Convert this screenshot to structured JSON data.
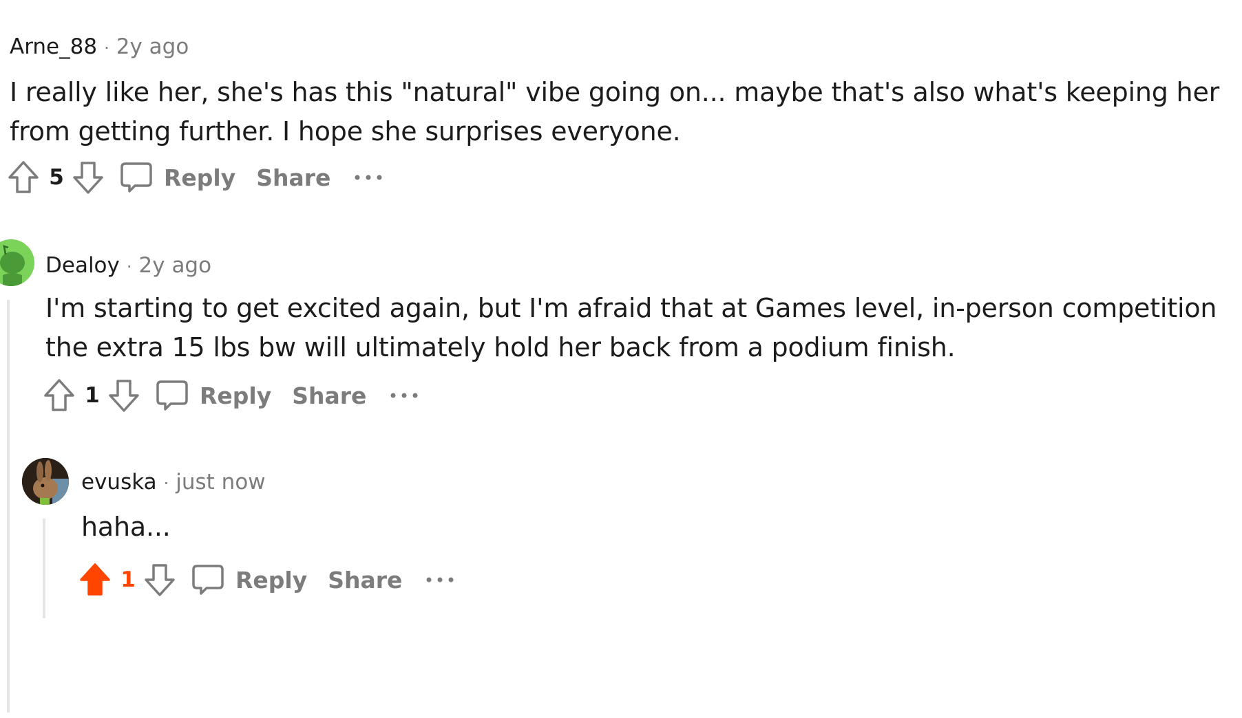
{
  "colors": {
    "upvoted": "#ff4500",
    "muted": "#7c7c7c",
    "text": "#1c1c1c",
    "thread_line": "#e5e5e5",
    "avatar_green": "#7bd35a"
  },
  "comments": [
    {
      "username": "Arne_88",
      "separator": "·",
      "time": "2y ago",
      "lines": [
        "I really like her, she's has this \"natural\" vibe going on... maybe that's also what's keeping her",
        "from getting further. I hope she surprises everyone."
      ],
      "score": "5",
      "upvoted": false,
      "reply_label": "Reply",
      "share_label": "Share",
      "more_icon": "more-icon"
    },
    {
      "username": "Dealoy",
      "separator": "·",
      "time": "2y ago",
      "avatar_icon": "snoo-avatar-green",
      "lines": [
        "I'm starting to get excited again, but I'm afraid that at Games level, in-person competition",
        "the extra 15 lbs bw will ultimately hold her back from a podium finish."
      ],
      "score": "1",
      "upvoted": false,
      "reply_label": "Reply",
      "share_label": "Share",
      "more_icon": "more-icon"
    },
    {
      "username": "evuska",
      "separator": "·",
      "time": "just now",
      "avatar_icon": "rabbit-photo-avatar",
      "lines": [
        "haha..."
      ],
      "score": "1",
      "upvoted": true,
      "reply_label": "Reply",
      "share_label": "Share",
      "more_icon": "more-icon"
    }
  ]
}
